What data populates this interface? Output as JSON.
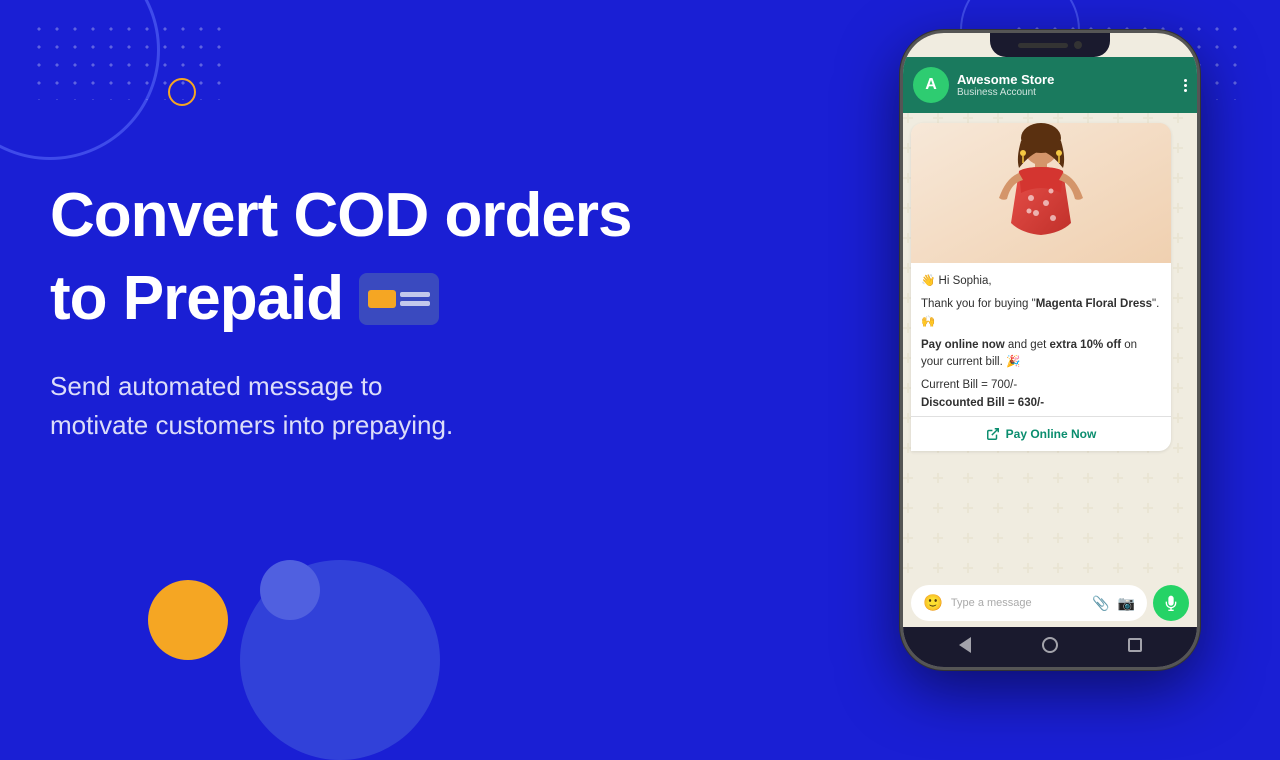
{
  "background": {
    "color": "#1a1fd4"
  },
  "left": {
    "heading_line1": "Convert COD orders",
    "heading_line2": "to Prepaid",
    "subtitle_line1": "Send automated message to",
    "subtitle_line2": "motivate customers into prepaying."
  },
  "phone": {
    "store_name": "Awesome Store",
    "account_type": "Business Account",
    "avatar_letter": "A",
    "greeting": "👋 Hi Sophia,",
    "message1": "Thank you for buying \"",
    "product_name": "Magenta Floral Dress",
    "message1_end": "\". 🙌",
    "message2_start": "Pay online now",
    "message2_mid": " and get ",
    "message2_bold": "extra 10% off",
    "message2_end": " on your current bill. 🎉",
    "bill_label": "Current Bill = 700/-",
    "discounted_label": "Discounted Bill = 630/-",
    "pay_btn_label": "Pay Online Now",
    "input_placeholder": "Type a message",
    "nav_back": "◁",
    "nav_home": "○",
    "nav_recent": "□"
  }
}
